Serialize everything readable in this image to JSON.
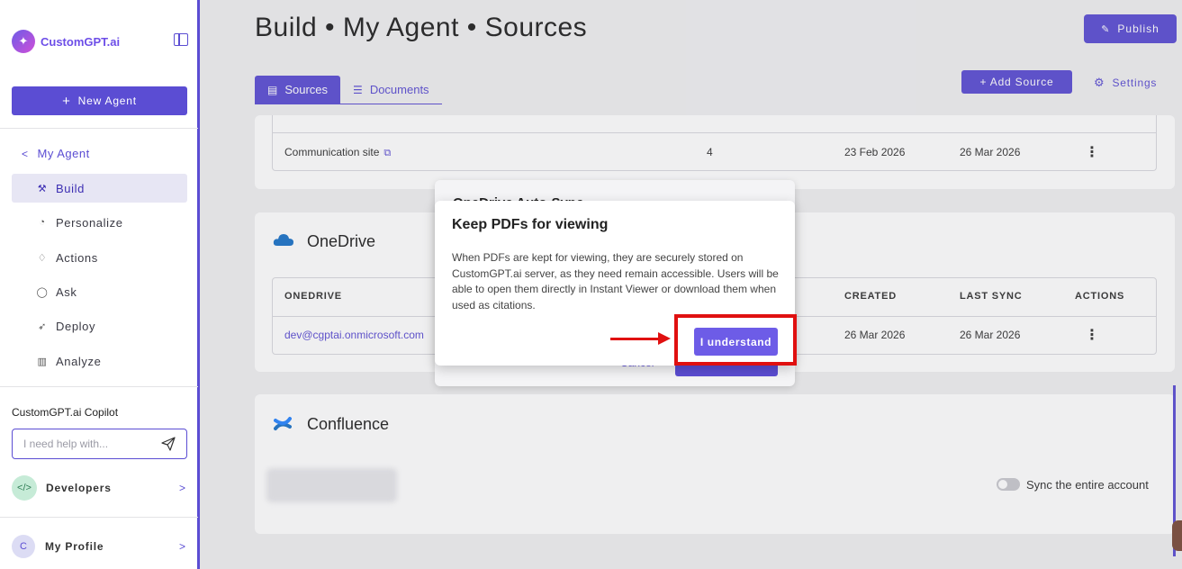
{
  "sidebar": {
    "brand": "CustomGPT.ai",
    "new_agent": "New Agent",
    "back_label": "My Agent",
    "items": [
      {
        "label": "Build",
        "icon": "build-icon",
        "active": true
      },
      {
        "label": "Personalize",
        "icon": "palette-icon"
      },
      {
        "label": "Actions",
        "icon": "actions-icon"
      },
      {
        "label": "Ask",
        "icon": "chat-icon"
      },
      {
        "label": "Deploy",
        "icon": "rocket-icon"
      },
      {
        "label": "Analyze",
        "icon": "chart-icon"
      }
    ],
    "copilot_title": "CustomGPT.ai Copilot",
    "copilot_placeholder": "I need help with...",
    "developers": "Developers",
    "profile_initial": "C",
    "profile": "My Profile"
  },
  "header": {
    "title": "Build • My Agent • Sources",
    "publish": "Publish"
  },
  "tabs": [
    {
      "label": "Sources",
      "active": true
    },
    {
      "label": "Documents",
      "active": false
    }
  ],
  "toolbar": {
    "add_source": "+ Add Source",
    "settings": "Settings"
  },
  "sharepoint_row": {
    "name": "Communication site",
    "count": "4",
    "created": "23 Feb 2026",
    "last_sync": "26 Mar 2026"
  },
  "onedrive": {
    "title": "OneDrive",
    "headers": [
      "ONEDRIVE",
      "CREATED",
      "LAST SYNC",
      "ACTIONS"
    ],
    "row": {
      "account": "dev@cgptai.onmicrosoft.com",
      "created": "26 Mar 2026",
      "last_sync": "26 Mar 2026"
    }
  },
  "confluence": {
    "title": "Confluence",
    "sync_label": "Sync the entire account"
  },
  "back_modal": {
    "title": "OneDrive Auto-Sync",
    "cancel": "Cancel"
  },
  "modal": {
    "title": "Keep PDFs for viewing",
    "body": "When PDFs are kept for viewing, they are securely stored on CustomGPT.ai server, as they need remain accessible. Users will be able to open them directly in Instant Viewer or download them when used as citations.",
    "button": "I understand"
  },
  "colors": {
    "accent": "#5b4dd3",
    "annotation": "#e01010"
  }
}
